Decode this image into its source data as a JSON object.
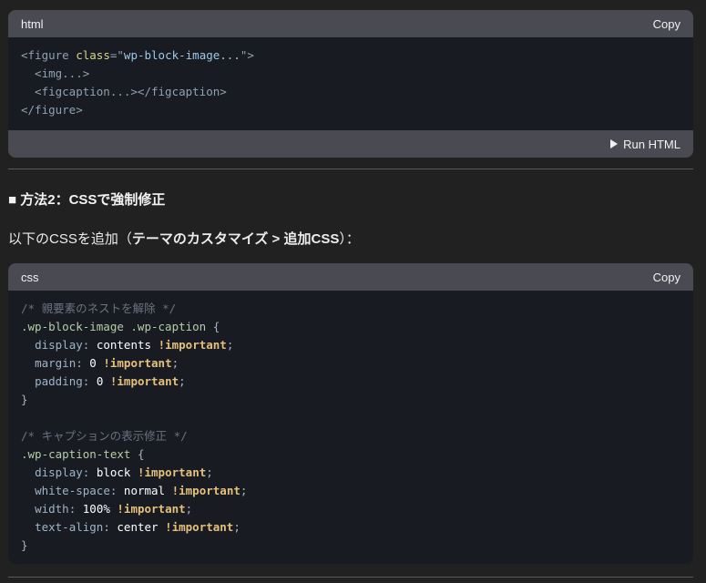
{
  "html_block": {
    "lang": "html",
    "copy_label": "Copy",
    "run_label": "Run HTML",
    "lines": [
      {
        "a": "<figure ",
        "b": "class",
        "c": "=\"",
        "d": "wp-block-image...",
        "e": "\">"
      },
      {
        "a": "  <img...>"
      },
      {
        "a": "  <figcaption...></figcaption>"
      },
      {
        "a": "</figure>"
      }
    ]
  },
  "heading": {
    "bullet": "■",
    "text": "方法2：CSSで強制修正"
  },
  "para": {
    "pre": "以下のCSSを追加（",
    "bold": "テーマのカスタマイズ > 追加CSS",
    "post": "）："
  },
  "css_block": {
    "lang": "css",
    "copy_label": "Copy",
    "comment1": "/* 親要素のネストを解除 */",
    "selector1": ".wp-block-image .wp-caption",
    "rules1": [
      {
        "prop": "display",
        "val": "contents"
      },
      {
        "prop": "margin",
        "val": "0"
      },
      {
        "prop": "padding",
        "val": "0"
      }
    ],
    "comment2": "/* キャプションの表示修正 */",
    "selector2": ".wp-caption-text",
    "rules2": [
      {
        "prop": "display",
        "val": "block"
      },
      {
        "prop": "white-space",
        "val": "normal"
      },
      {
        "prop": "width",
        "val": "100%"
      },
      {
        "prop": "text-align",
        "val": "center"
      }
    ],
    "important": "!important"
  }
}
